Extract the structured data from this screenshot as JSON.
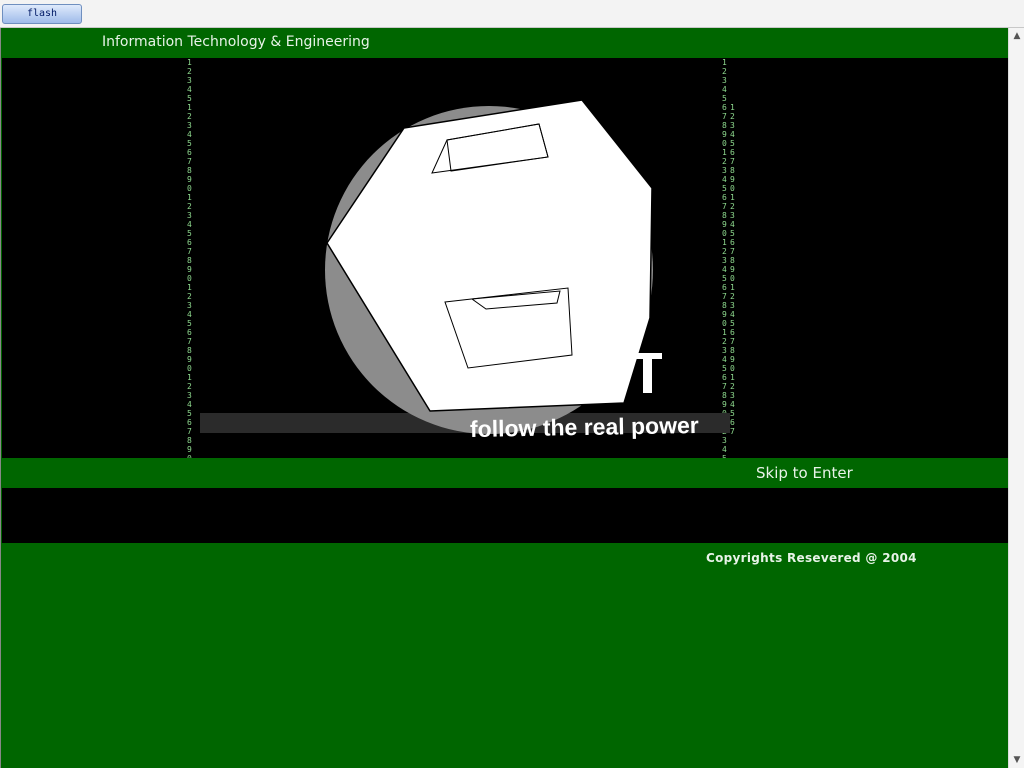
{
  "browser": {
    "tab_label": "flash"
  },
  "page": {
    "header_title": "Information Technology & Engineering",
    "skip_link": "Skip to Enter",
    "copyright": "Copyrights Resevered @ 2004"
  },
  "flash": {
    "tagline": "follow the real power",
    "logo_letter": "T",
    "left_digits": "1\n2\n3\n4\n5\n1\n2\n3\n4\n5\n6\n7\n8\n9\n0\n1\n2\n3\n4\n5\n6\n7\n8\n9\n0\n1\n2\n3\n4\n5\n6\n7\n8\n9\n0\n1\n2\n3\n4\n5\n6\n7\n8\n9\n0\n1\n2",
    "right_digits_a": "1\n2\n3\n4\n5\n6\n7\n8\n9\n0\n1\n2\n3\n4\n5\n6\n7\n8\n9\n0\n1\n2\n3\n4\n5\n6\n7\n8\n9\n0\n1\n2\n3\n4\n5\n6\n7\n8\n9\n0\n1\n2\n3\n4\n5",
    "right_digits_b": "1\n2\n3\n4\n5\n6\n7\n8\n9\n0\n1\n2\n3\n4\n5\n6\n7\n8\n9\n0\n1\n2\n3\n4\n5\n6\n7\n8\n9\n0\n1\n2\n3\n4\n5\n6\n7"
  },
  "colors": {
    "green": "#006600",
    "black": "#000000",
    "digit_green": "#8ed98e"
  }
}
